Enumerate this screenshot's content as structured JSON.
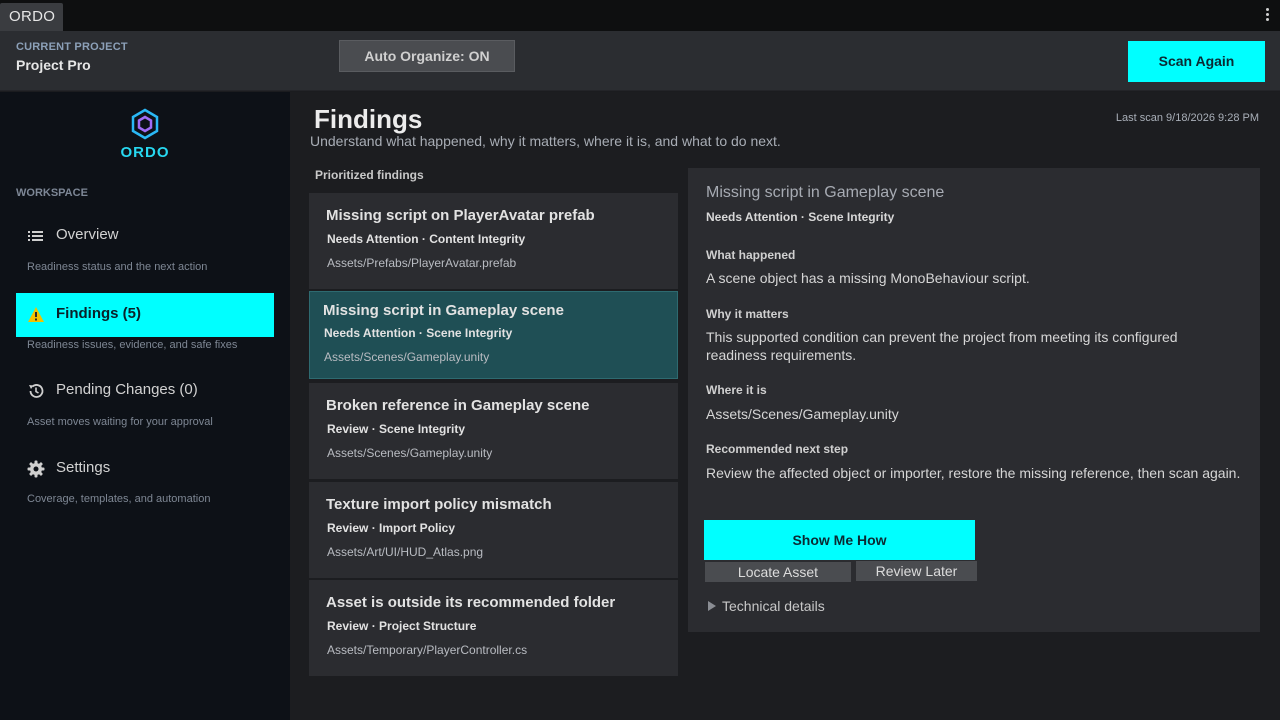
{
  "tab": {
    "label": "ORDO"
  },
  "header": {
    "project_label": "CURRENT PROJECT",
    "project_name": "Project Pro",
    "auto_organize": "Auto Organize: ON",
    "scan_again": "Scan Again"
  },
  "sidebar": {
    "logo_text": "ORDO",
    "section_label": "WORKSPACE",
    "items": [
      {
        "label": "Overview",
        "desc": "Readiness status and the next action",
        "icon": "list-icon",
        "active": false
      },
      {
        "label": "Findings (5)",
        "desc": "Readiness issues, evidence, and safe fixes",
        "icon": "warning-icon",
        "active": true
      },
      {
        "label": "Pending Changes (0)",
        "desc": "Asset moves waiting for your approval",
        "icon": "history-icon",
        "active": false
      },
      {
        "label": "Settings",
        "desc": "Coverage, templates, and automation",
        "icon": "gear-icon",
        "active": false
      }
    ]
  },
  "main": {
    "title": "Findings",
    "subtitle": "Understand what happened, why it matters, where it is, and what to do next.",
    "last_scan": "Last scan 9/18/2026 9:28 PM",
    "list_label": "Prioritized findings",
    "findings": [
      {
        "title": "Missing script on PlayerAvatar prefab",
        "meta": "Needs Attention · Content Integrity",
        "path": "Assets/Prefabs/PlayerAvatar.prefab"
      },
      {
        "title": "Missing script in Gameplay scene",
        "meta": "Needs Attention · Scene Integrity",
        "path": "Assets/Scenes/Gameplay.unity"
      },
      {
        "title": "Broken reference in Gameplay scene",
        "meta": "Review · Scene Integrity",
        "path": "Assets/Scenes/Gameplay.unity"
      },
      {
        "title": "Texture import policy mismatch",
        "meta": "Review · Import Policy",
        "path": "Assets/Art/UI/HUD_Atlas.png"
      },
      {
        "title": "Asset is outside its recommended folder",
        "meta": "Review · Project Structure",
        "path": "Assets/Temporary/PlayerController.cs"
      }
    ]
  },
  "detail": {
    "title": "Missing script in Gameplay scene",
    "meta": "Needs Attention · Scene Integrity",
    "what_happened_label": "What happened",
    "what_happened": "A scene object has a missing MonoBehaviour script.",
    "why_label": "Why it matters",
    "why": "This supported condition can prevent the project from meeting its configured readiness requirements.",
    "where_label": "Where it is",
    "where": "Assets/Scenes/Gameplay.unity",
    "next_label": "Recommended next step",
    "next": "Review the affected object or importer, restore the missing reference, then scan again.",
    "show_me_how": "Show Me How",
    "locate_asset": "Locate Asset",
    "review_later": "Review Later",
    "technical_details": "Technical details"
  },
  "colors": {
    "accent": "#00ffff",
    "selected_card": "#1f4f55",
    "warning": "#f2c200",
    "logo": "#27d8f0"
  }
}
